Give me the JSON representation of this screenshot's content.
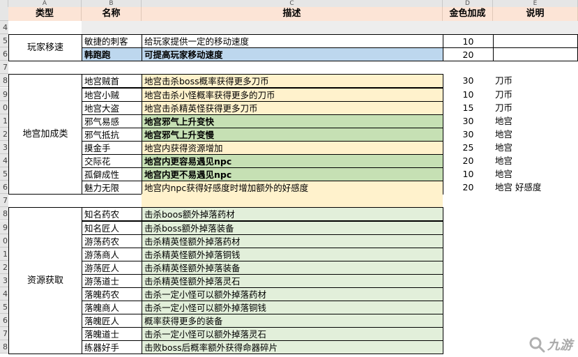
{
  "columns": [
    "A",
    "B",
    "C",
    "D",
    "E"
  ],
  "header": {
    "type": "类型",
    "name": "名称",
    "desc": "描述",
    "gold": "金色加成",
    "note": "说明"
  },
  "categories": [
    {
      "label": "玩家移速"
    },
    {
      "label": "地宫加成类"
    },
    {
      "label": "资源获取"
    }
  ],
  "rows": [
    {
      "num": "4",
      "name": "",
      "desc": "",
      "gold": "",
      "note": ""
    },
    {
      "num": "5",
      "name": "敏捷的刺客",
      "desc": "给玩家提供一定的移动速度",
      "gold": "10",
      "note": ""
    },
    {
      "num": "6",
      "name": "韩跑跑",
      "desc": "可提高玩家移动速度",
      "gold": "20",
      "note": ""
    },
    {
      "num": "7",
      "name": "",
      "desc": "",
      "gold": "",
      "note": ""
    },
    {
      "num": "8",
      "name": "地宫贼首",
      "desc": "地宫击杀boss概率获得更多刀币",
      "gold": "30",
      "note": "刀币"
    },
    {
      "num": "9",
      "name": "地宫小贼",
      "desc": "地宫击杀小怪概率获得更多的刀币",
      "gold": "10",
      "note": "刀币"
    },
    {
      "num": "0",
      "name": "地宫大盗",
      "desc": "地宫击杀精英怪获得更多刀币",
      "gold": "15",
      "note": "刀币"
    },
    {
      "num": "1",
      "name": "邪气易感",
      "desc": "地宫邪气上升变快",
      "gold": "30",
      "note": "地宫"
    },
    {
      "num": "2",
      "name": "邪气抵抗",
      "desc": "地宫邪气上升变慢",
      "gold": "30",
      "note": "地宫"
    },
    {
      "num": "3",
      "name": "摸金手",
      "desc": "地宫内获得资源增加",
      "gold": "25",
      "note": "地宫"
    },
    {
      "num": "4",
      "name": "交际花",
      "desc": "地宫内更容易遇见npc",
      "gold": "20",
      "note": "地宫"
    },
    {
      "num": "5",
      "name": "孤僻成性",
      "desc": "地宫内更不易遇见npc",
      "gold": "10",
      "note": "地宫"
    },
    {
      "num": "6",
      "name": "魅力无限",
      "desc": "地宫内npc获得好感度时增加额外的好感度",
      "gold": "20",
      "note": "地宫  好感度"
    },
    {
      "num": "7",
      "name": "",
      "desc": "",
      "gold": "",
      "note": ""
    },
    {
      "num": "8",
      "name": "知名药农",
      "desc": "击杀boos额外掉落药材",
      "gold": "",
      "note": ""
    },
    {
      "num": "9",
      "name": "知名匠人",
      "desc": "击杀boss额外掉落装备",
      "gold": "",
      "note": ""
    },
    {
      "num": "0",
      "name": "游荡药农",
      "desc": "击杀精英怪额外掉落药材",
      "gold": "",
      "note": ""
    },
    {
      "num": "1",
      "name": "游荡商人",
      "desc": "击杀精英怪额外掉落铜钱",
      "gold": "",
      "note": ""
    },
    {
      "num": "2",
      "name": "游荡匠人",
      "desc": "击杀精英怪额外掉落装备",
      "gold": "",
      "note": ""
    },
    {
      "num": "3",
      "name": "游荡道士",
      "desc": "击杀精英怪额外掉落灵石",
      "gold": "",
      "note": ""
    },
    {
      "num": "4",
      "name": "落魄药农",
      "desc": "击杀一定小怪可以额外掉落药材",
      "gold": "",
      "note": ""
    },
    {
      "num": "5",
      "name": "落魄商人",
      "desc": "击杀一定小怪可以额外掉落铜钱",
      "gold": "",
      "note": ""
    },
    {
      "num": "6",
      "name": "落魄匠人",
      "desc": "概率获得更多的装备",
      "gold": "",
      "note": ""
    },
    {
      "num": "7",
      "name": "落魄道士",
      "desc": "击杀一定小怪可以额外掉落灵石",
      "gold": "",
      "note": ""
    },
    {
      "num": "8",
      "name": "练器好手",
      "desc": "击败boss后概率额外获得命器碎片",
      "gold": "",
      "note": ""
    }
  ],
  "watermark": {
    "text": "九游",
    "icon": "jiuyou-logo-icon"
  }
}
